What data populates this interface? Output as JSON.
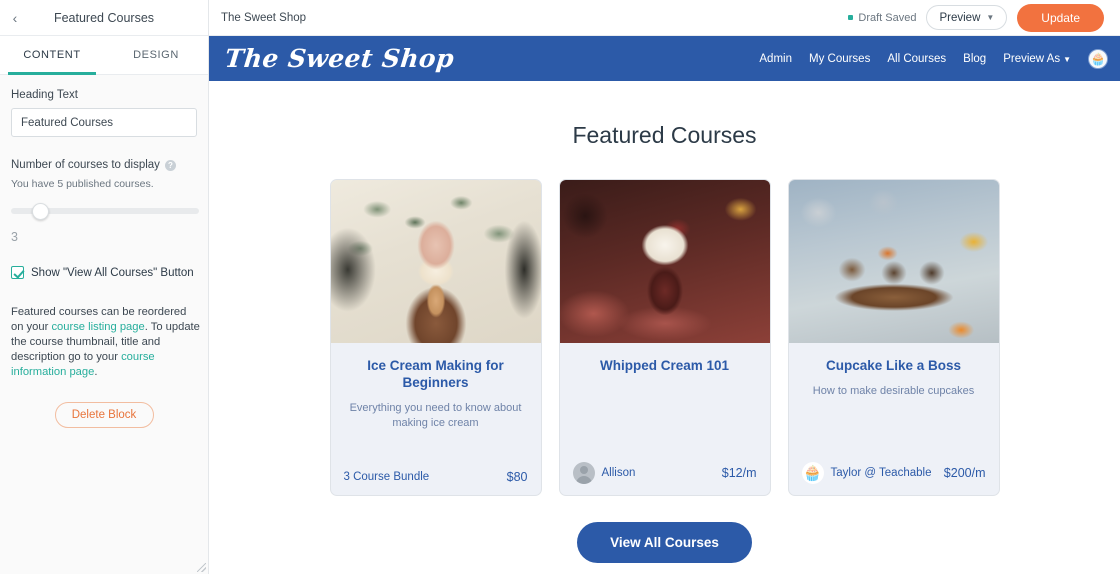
{
  "sidebar": {
    "back_icon": "chevron-left-icon",
    "title": "Featured Courses",
    "tabs": [
      {
        "label": "CONTENT",
        "active": true
      },
      {
        "label": "DESIGN",
        "active": false
      }
    ],
    "heading_field": {
      "label": "Heading Text",
      "value": "Featured Courses",
      "placeholder": "Heading Text"
    },
    "courses_count": {
      "label": "Number of courses to display",
      "help_icon": "question-mark-icon",
      "note": "You have 5 published courses.",
      "slider_value": "3",
      "slider_min": 1,
      "slider_max": 5
    },
    "show_button_checkbox": {
      "label": "Show \"View All Courses\" Button",
      "checked": true
    },
    "info": {
      "part1": "Featured courses can be reordered on your ",
      "link1": "course listing page",
      "part2": ". To update the course thumbnail, title and description go to your ",
      "link2": "course information page",
      "part3": "."
    },
    "delete_button": "Delete Block",
    "resize_handle": "resize-handle-icon"
  },
  "topbar": {
    "shop_name": "The Sweet Shop",
    "draft_status": "Draft Saved",
    "preview_label": "Preview",
    "preview_caret": "chevron-down-icon",
    "update_label": "Update"
  },
  "site_nav": {
    "logo": "The Sweet Shop",
    "links": [
      {
        "label": "Admin"
      },
      {
        "label": "My Courses"
      },
      {
        "label": "All Courses"
      },
      {
        "label": "Blog"
      },
      {
        "label": "Preview As",
        "caret": "▾"
      }
    ],
    "avatar_icon": "cupcake-avatar-icon",
    "avatar_glyph": "🧁",
    "background_color": "#2c5aa8"
  },
  "page": {
    "title": "Featured Courses",
    "cards": [
      {
        "image": "ice-cream-cone-photo",
        "title": "Ice Cream Making for Beginners",
        "description": "Everything you need to know about making ice cream",
        "footer_label": "3 Course Bundle",
        "price": "$80",
        "avatar": null
      },
      {
        "image": "whipped-cream-sundae-photo",
        "title": "Whipped Cream 101",
        "description": "",
        "footer_label": "Allison",
        "price": "$12/m",
        "avatar": "person-avatar-icon"
      },
      {
        "image": "cupcakes-on-board-photo",
        "title": "Cupcake Like a Boss",
        "description": "How to make desirable cupcakes",
        "footer_label": "Taylor @ Teachable",
        "price": "$200/m",
        "avatar": "cupcake-avatar-icon",
        "avatar_glyph": "🧁"
      }
    ],
    "cta_label": "View All Courses"
  },
  "colors": {
    "brand_blue": "#2c5aa8",
    "accent_teal": "#27ae9c",
    "update_orange": "#f2723f",
    "delete_orange": "#e8743b",
    "card_bg": "#eef1f7"
  }
}
